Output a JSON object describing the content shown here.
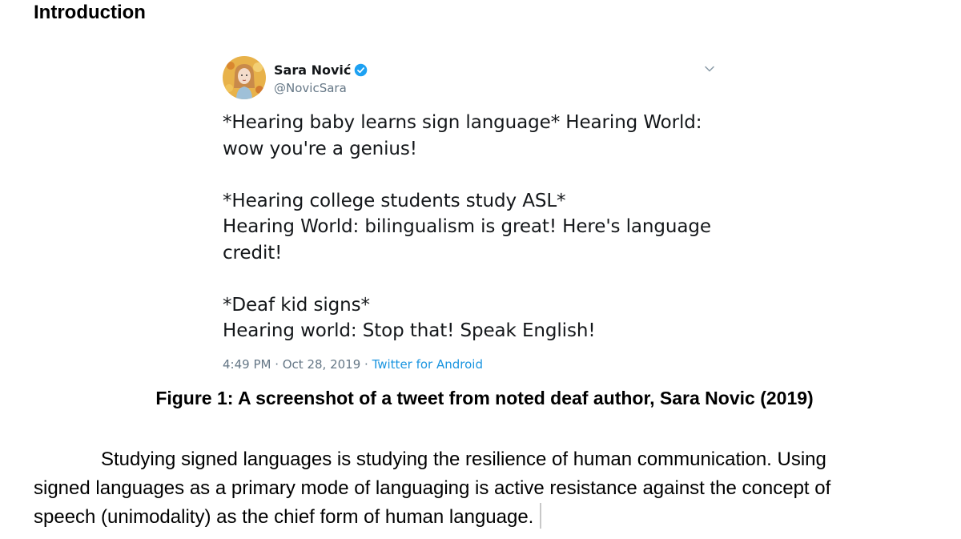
{
  "document": {
    "heading": "Introduction",
    "caption": "Figure 1: A screenshot of a tweet from noted deaf author, Sara Novic (2019)",
    "paragraph": {
      "lines": [
        "Studying signed languages is studying the resilience of human communication. Using",
        "signed languages as a primary mode of languaging is active resistance against the concept of",
        "speech (unimodality) as the chief form of human language."
      ]
    }
  },
  "tweet": {
    "author_name": "Sara Nović",
    "handle": "@NovicSara",
    "verified": true,
    "body_lines": [
      "*Hearing baby learns sign language* Hearing World:",
      "wow you're a genius!",
      "",
      "*Hearing college students study ASL*",
      "Hearing World: bilingualism is great! Here's language",
      "credit!",
      "",
      "*Deaf kid signs*",
      "Hearing world: Stop that! Speak English!"
    ],
    "timestamp": "4:49 PM · Oct 28, 2019 · ",
    "source": "Twitter for Android",
    "colors": {
      "verified_blue": "#1da1f2",
      "link_blue": "#1b95e0",
      "muted_gray": "#657786"
    },
    "icons": {
      "verified": "verified-badge-icon",
      "menu": "chevron-down-icon",
      "avatar": "author-avatar"
    }
  }
}
